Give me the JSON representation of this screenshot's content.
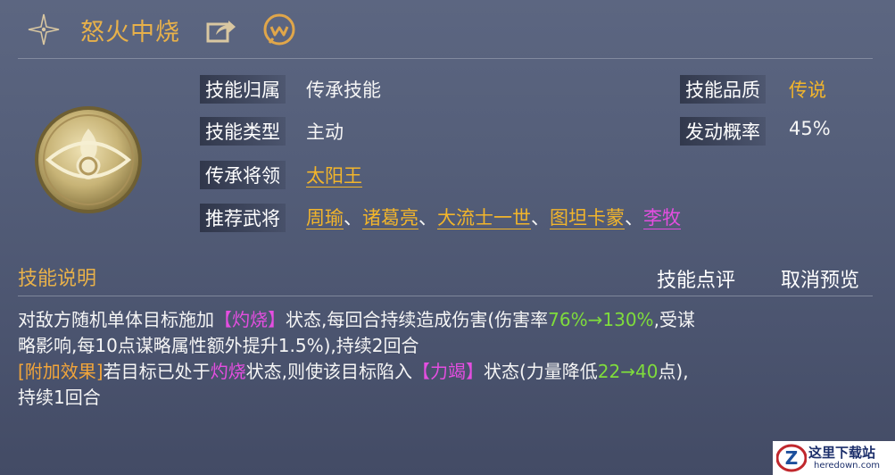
{
  "header": {
    "title": "怒火中烧"
  },
  "info": {
    "belong_label": "技能归属",
    "belong_value": "传承技能",
    "type_label": "技能类型",
    "type_value": "主动",
    "general_label": "传承将领",
    "general_value": "太阳王",
    "recommend_label": "推荐武将",
    "recommend": [
      {
        "name": "周瑜",
        "color": "#f2b52b"
      },
      {
        "name": "诸葛亮",
        "color": "#f2b52b"
      },
      {
        "name": "大流士一世",
        "color": "#f2b52b"
      },
      {
        "name": "图坦卡蒙",
        "color": "#f2b52b"
      },
      {
        "name": "李牧",
        "color": "#e44ee0"
      }
    ],
    "separator": "、",
    "quality_label": "技能品质",
    "quality_value": "传说",
    "prob_label": "发动概率",
    "prob_value": "45%"
  },
  "section": {
    "title": "技能说明",
    "review_button": "技能点评",
    "cancel_button": "取消预览"
  },
  "description": {
    "l1a": "对敌方随机单体目标施加",
    "l1b": "【灼烧】",
    "l1c": "状态,每回合持续造成伤害(伤害率",
    "l1d": "76%→130%",
    "l1e": ",受谋",
    "l2": "略影响,每10点谋略属性额外提升1.5%),持续2回合",
    "l3a": "[附加效果]",
    "l3b": "若目标已处于",
    "l3c": "灼烧",
    "l3d": "状态,则使该目标陷入",
    "l3e": "【力竭】",
    "l3f": "状态(力量降低",
    "l3g": "22→40",
    "l3h": "点),",
    "l4": "持续1回合"
  },
  "watermark": {
    "brand": "这里下载站",
    "url": "heredown.com",
    "letter": "Z"
  },
  "colors": {
    "gold": "#f2b52b",
    "purple": "#e44ee0",
    "green": "#7fdc3c",
    "title": "#e8b14a"
  }
}
